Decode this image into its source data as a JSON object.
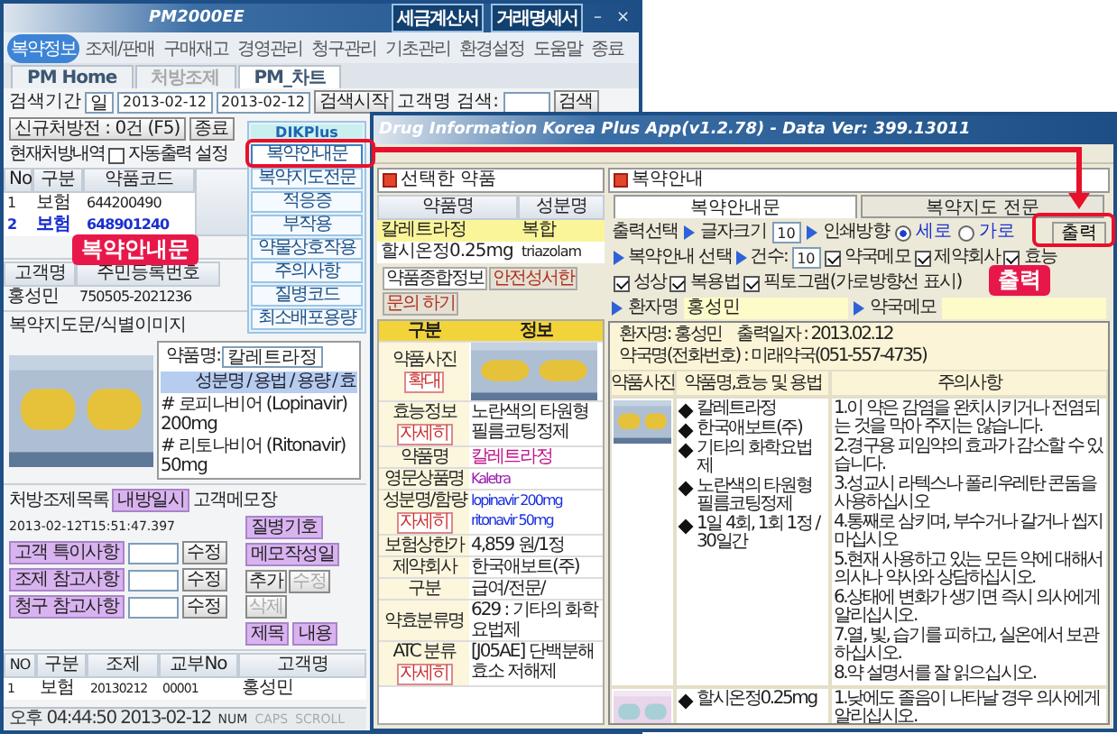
{
  "back_window": {
    "title": "PM2000EE",
    "controls": [
      "–",
      "×"
    ],
    "nav": [
      {
        "label": "복약정보",
        "selected": true
      },
      {
        "label": "조제/판매",
        "selected": false
      },
      {
        "label": "구매재고",
        "selected": false
      },
      {
        "label": "경영관리",
        "selected": false
      },
      {
        "label": "청구관리",
        "selected": false
      },
      {
        "label": "기초관리",
        "selected": false
      },
      {
        "label": "환경설정",
        "selected": false
      },
      {
        "label": "도움말",
        "selected": false
      },
      {
        "label": "종료",
        "selected": false
      }
    ],
    "doc_buttons": [
      "세금계산서",
      "거래명세서"
    ],
    "tabs": [
      {
        "label": "PM Home",
        "selected": false,
        "disabled": false
      },
      {
        "label": "처방조제",
        "selected": false,
        "disabled": true
      },
      {
        "label": "PM_차트",
        "selected": true,
        "disabled": false
      }
    ],
    "search": {
      "period_label": "검색기간",
      "unit": "일",
      "from": "2013-02-12",
      "to": "2013-02-12",
      "start_button": "검색시작",
      "customer_label": "고객명 검색:",
      "search_button": "검색",
      "new_rx": "신규처방전 : 0건 (F5)",
      "close_button": "종료"
    },
    "current": {
      "label": "현재처방내역",
      "auto_print": {
        "label": "자동출력 설정",
        "checked": false
      }
    },
    "rx_table": {
      "columns": [
        "No",
        "구분",
        "약품코드"
      ],
      "rows": [
        {
          "cells": [
            "1",
            "보험",
            "644200490"
          ],
          "selected": false
        },
        {
          "cells": [
            "2",
            "보험",
            "648901240"
          ],
          "selected": true
        }
      ]
    },
    "side_menu": {
      "title": "DIKPlus",
      "items": [
        {
          "label": "복약안내문",
          "selected": true
        },
        {
          "label": "복약지도전문",
          "selected": false
        },
        {
          "label": "적응증",
          "selected": false
        },
        {
          "label": "부작용",
          "selected": false
        },
        {
          "label": "약물상호작용",
          "selected": false
        },
        {
          "label": "주의사항",
          "selected": false
        },
        {
          "label": "질병코드",
          "selected": false
        },
        {
          "label": "최소배포용량",
          "selected": false
        }
      ]
    },
    "customer": {
      "columns": [
        "고객명",
        "주민등록번호"
      ],
      "values": [
        "홍성민",
        "750505-2021236"
      ]
    },
    "image_section": {
      "label": "복약지도문/식별이미지",
      "drug_label": "약품명:",
      "drug_name": "칼레트라정",
      "info_header": "성분명 / 용법 / 용량 / 효",
      "lines": [
        "# 로피나비어 (Lopinavir) 200mg",
        "# 리토나비어 (Ritonavir) 50mg"
      ]
    },
    "list_section": {
      "label": "처방조제목록",
      "visit_button": "내방일시",
      "visit": "2013-02-12T15:51:47.397",
      "memo_label": "고객메모장",
      "disease_button": "질병기호",
      "notes": [
        {
          "label": "고객 특이사항",
          "button": "수정"
        },
        {
          "label": "조제 참고사항",
          "button": "수정"
        },
        {
          "label": "청구 참고사항",
          "button": "수정"
        }
      ],
      "memo_date_button": "메모작성일",
      "title_button": "제목",
      "content_button": "내용",
      "actions": [
        {
          "label": "추가",
          "disabled": false
        },
        {
          "label": "수정",
          "disabled": true
        },
        {
          "label": "삭제",
          "disabled": true
        }
      ]
    },
    "list_table": {
      "columns": [
        "NO",
        "구분",
        "조제",
        "교부No",
        "고객명"
      ],
      "rows": [
        [
          "1",
          "보험",
          "20130212",
          "00001",
          "홍성민"
        ]
      ]
    },
    "status_bar": [
      {
        "text": "오후 04:44:50 2013-02-12",
        "disabled": false
      },
      {
        "text": "NUM",
        "disabled": false
      },
      {
        "text": "CAPS",
        "disabled": true
      },
      {
        "text": "SCROLL",
        "disabled": true
      }
    ]
  },
  "front_window": {
    "title": "Drug Information Korea Plus App(v1.2.78) - Data Ver: 399.13011",
    "selected_drugs": {
      "title": "선택한 약품",
      "columns": [
        "약품명",
        "성분명"
      ],
      "rows": [
        {
          "cells": [
            "칼레트라정",
            "복합"
          ],
          "selected": true
        },
        {
          "cells": [
            "할시온정0.25mg",
            "triazolam"
          ],
          "selected": false
        }
      ]
    },
    "info_tabs": [
      {
        "label": "약품종합정보",
        "selected": true
      },
      {
        "label": "안전성서한",
        "selected": false
      },
      {
        "label": "문의 하기",
        "selected": false
      }
    ],
    "info_table": {
      "columns": [
        "구분",
        "정보"
      ],
      "rows": [
        {
          "kind": "picture",
          "label": "약품사진",
          "button": "확대"
        },
        {
          "kind": "text",
          "label": "효능정보",
          "button": "자세히",
          "value": "노란색의 타원형 필름코팅정제",
          "color": "#222222"
        },
        {
          "kind": "text",
          "label": "약품명",
          "value": "칼레트라정",
          "color": "#c0148c"
        },
        {
          "kind": "text",
          "label": "영문상품명",
          "value": "Kaletra",
          "color": "#9b1fb0"
        },
        {
          "kind": "text",
          "label": "성분명/함량",
          "button": "자세히",
          "value": "lopinavir 200mg ritonavir 50mg",
          "color": "#1a2fe0"
        },
        {
          "kind": "text",
          "label": "보험상한가",
          "value": "4,859 원/1정",
          "color": "#222222"
        },
        {
          "kind": "text",
          "label": "제약회사",
          "value": "한국애보트(주)",
          "color": "#222222"
        },
        {
          "kind": "text",
          "label": "구분",
          "value": "급여/전문/",
          "color": "#222222"
        },
        {
          "kind": "text",
          "label": "약효분류명",
          "value": "629 : 기타의 화학요법제",
          "color": "#222222"
        },
        {
          "kind": "text",
          "label": "ATC 분류",
          "button": "자세히",
          "value": "[J05AE] 단백분해효소 저해제",
          "color": "#222222"
        }
      ]
    },
    "guide": {
      "title": "복약안내",
      "tabs": [
        {
          "label": "복약안내문",
          "selected": true
        },
        {
          "label": "복약지도 전문",
          "selected": false
        }
      ],
      "print_button": "출력",
      "options": {
        "print_select": "출력선택",
        "font_size_label": "글자크기",
        "font_size": "10",
        "orientation_label": "인쇄방향",
        "orientations": [
          {
            "label": "세로",
            "selected": true
          },
          {
            "label": "가로",
            "selected": false
          }
        ],
        "guide_select": "복약안내 선택",
        "count_label": "건수:",
        "count": "10",
        "checks": [
          {
            "label": "약국메모",
            "checked": true
          },
          {
            "label": "제약회사",
            "checked": true
          },
          {
            "label": "효능",
            "checked": true
          },
          {
            "label": "성상",
            "checked": true
          },
          {
            "label": "복용법",
            "checked": true
          },
          {
            "label": "픽토그램(가로방향선 표시)",
            "checked": true
          }
        ],
        "patient_label": "환자명",
        "patient": "홍성민",
        "memo_label": "약국메모"
      },
      "document": {
        "patient": "환자명: 홍성민",
        "print_date": "출력일자 : 2013.02.12",
        "pharmacy": "약국명(전화번호) : 미래약국(051-557-4735)",
        "columns": [
          "약품사진",
          "약품명,효능 및 용법",
          "주의사항"
        ],
        "rows": [
          {
            "kind": "picture",
            "bullets": [
              "칼레트라정",
              "한국애보트(주)",
              "기타의 화학요법제",
              "노란색의 타원형 필름코팅정제",
              "1일 4회, 1회 1정 / 30일간"
            ],
            "notes": [
              "1.이 약은 감염을 완치시키거나 전염되는 것을 막아 주지는 않습니다.",
              "2.경구용 피임약의 효과가 감소할 수 있습니다.",
              "3.성교시 라텍스나 폴리우레탄 콘돔을 사용하십시오",
              "4.통째로 삼키며, 부수거나 갈거나 씹지 마십시오",
              "5.현재 사용하고 있는 모든 약에 대해서 의사나 약사와 상담하십시오.",
              "6.상태에 변화가 생기면 즉시 의사에게 알리십시오.",
              "7.열, 빛, 습기를 피하고, 실온에서 보관하십시오.",
              "8.약 설명서를 잘 읽으십시오."
            ]
          },
          {
            "kind": "picture",
            "bullets": [
              "할시온정0.25mg"
            ],
            "notes": [
              "1.낮에도 졸음이 나타날 경우 의사에게 알리십시오."
            ]
          }
        ]
      }
    }
  },
  "callouts": [
    {
      "text": "복약안내문"
    },
    {
      "text": "출력"
    }
  ]
}
